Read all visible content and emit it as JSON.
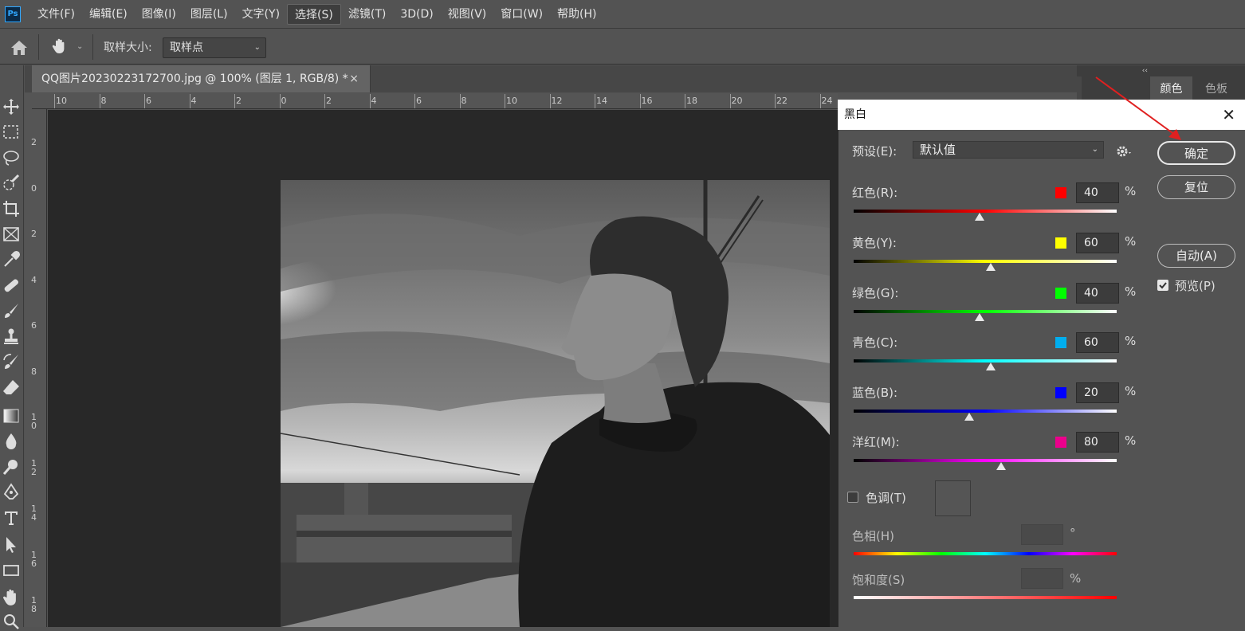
{
  "menubar": {
    "logo": "Ps",
    "items": [
      "文件(F)",
      "编辑(E)",
      "图像(I)",
      "图层(L)",
      "文字(Y)",
      "选择(S)",
      "滤镜(T)",
      "3D(D)",
      "视图(V)",
      "窗口(W)",
      "帮助(H)"
    ],
    "active_index": 5
  },
  "options": {
    "sample_size_label": "取样大小:",
    "sample_size_value": "取样点"
  },
  "document_tab": {
    "title": "QQ图片20230223172700.jpg @ 100% (图层 1, RGB/8) *",
    "close": "×"
  },
  "ruler_top": [
    "10",
    "8",
    "6",
    "4",
    "2",
    "0",
    "2",
    "4",
    "6",
    "8",
    "10",
    "12",
    "14",
    "16",
    "18",
    "20",
    "22",
    "24"
  ],
  "ruler_left": [
    "2",
    "0",
    "2",
    "4",
    "6",
    "8",
    "10",
    "12",
    "14",
    "16",
    "18"
  ],
  "right_panel": {
    "collapse": "‹‹",
    "tabs": [
      "颜色",
      "色板"
    ]
  },
  "dialog": {
    "title": "黑白",
    "close": "✕",
    "preset_label": "预设(E):",
    "preset_value": "默认值",
    "ok_label": "确定",
    "reset_label": "复位",
    "auto_label": "自动(A)",
    "preview_label": "预览(P)",
    "preview_checked": true,
    "channels": [
      {
        "label": "红色(R):",
        "value": "40",
        "percent": "%",
        "color": "#ff0000",
        "gradient": [
          "#000000",
          "#ff0000",
          "#ffffff"
        ],
        "pos": 0.48
      },
      {
        "label": "黄色(Y):",
        "value": "60",
        "percent": "%",
        "color": "#ffff00",
        "gradient": [
          "#000000",
          "#ffff00",
          "#ffffff"
        ],
        "pos": 0.52
      },
      {
        "label": "绿色(G):",
        "value": "40",
        "percent": "%",
        "color": "#00ff00",
        "gradient": [
          "#000000",
          "#00ff00",
          "#ffffff"
        ],
        "pos": 0.48
      },
      {
        "label": "青色(C):",
        "value": "60",
        "percent": "%",
        "color": "#00aeef",
        "gradient": [
          "#000000",
          "#00ffff",
          "#ffffff"
        ],
        "pos": 0.52
      },
      {
        "label": "蓝色(B):",
        "value": "20",
        "percent": "%",
        "color": "#0000ff",
        "gradient": [
          "#000000",
          "#0000ff",
          "#ffffff"
        ],
        "pos": 0.44
      },
      {
        "label": "洋红(M):",
        "value": "80",
        "percent": "%",
        "color": "#ec008c",
        "gradient": [
          "#000000",
          "#ff00ff",
          "#ffffff"
        ],
        "pos": 0.56
      }
    ],
    "tint_label": "色调(T)",
    "hue_label": "色相(H)",
    "hue_unit": "°",
    "saturation_label": "饱和度(S)",
    "saturation_unit": "%"
  },
  "colors": {
    "accent_arrow": "#e02020"
  }
}
